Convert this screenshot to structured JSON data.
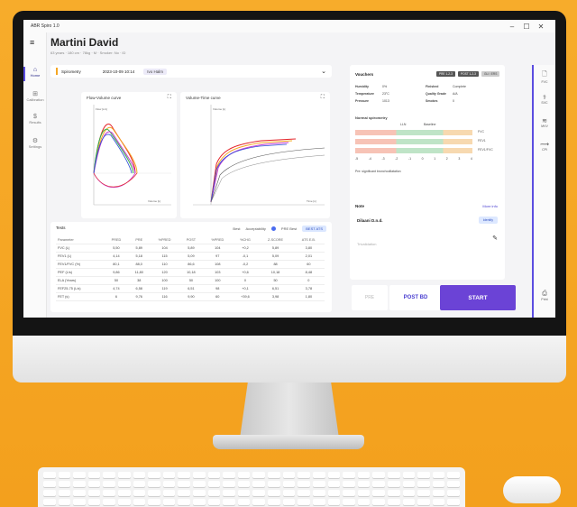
{
  "app": {
    "title": "ABR Spiro 1.0"
  },
  "window": {
    "minimize": "–",
    "maximize": "☐",
    "close": "✕"
  },
  "nav": {
    "menu_icon": "menu-icon",
    "items": [
      {
        "label": "Home",
        "icon": "home-icon",
        "glyph": "⌂"
      },
      {
        "label": "Calibration",
        "icon": "calibration-icon",
        "glyph": "⊞"
      },
      {
        "label": "Results",
        "icon": "results-icon",
        "glyph": "$"
      },
      {
        "label": "Settings",
        "icon": "gear-icon",
        "glyph": "⚙"
      }
    ]
  },
  "patient": {
    "name": "Martini David",
    "meta": "63 years · 180 cm · 78kg · M · Smoker: No · ID"
  },
  "test_bar": {
    "type": "Spirometry",
    "date": "2023-10-09 10:14",
    "badge": "Ivo Halm"
  },
  "charts": {
    "flow_volume": {
      "title": "Flow-Volume curve",
      "ylabel": "Flow [L/s]",
      "xlabel": "Volume [L]"
    },
    "volume_time": {
      "title": "Volume-Time curve",
      "ylabel": "Volume [L]",
      "xlabel": "Time [s]"
    }
  },
  "tests": {
    "label": "Tests",
    "best_label": "Best",
    "acceptability_label": "Acceptability",
    "pre_best_label": "PRE Best",
    "best_btn": "BEST ATS",
    "columns": [
      "Parameter",
      "PRED",
      "PRE",
      "%PRED",
      "POST",
      "%PRED",
      "%CHG",
      "Z-SCORE",
      "ATS E.B."
    ],
    "rows": [
      [
        "FVC (L)",
        "5,50",
        "5,89",
        "104",
        "5,89",
        "104",
        "+0,2",
        "5,89",
        "3,80"
      ],
      [
        "FEV1 (L)",
        "4,14",
        "5,18",
        "115",
        "5,09",
        "97",
        "-0,1",
        "5,09",
        "2,01"
      ],
      [
        "FEV1/FVC (%)",
        "80,1",
        "88,0",
        "110",
        "86,6",
        "108",
        "-0,2",
        "88",
        "60"
      ],
      [
        "PEF (L/s)",
        "9,86",
        "11,80",
        "120",
        "10,18",
        "103",
        "+0,6",
        "10,18",
        "8,48"
      ],
      [
        "ELA (Years)",
        "50",
        "38",
        "100",
        "50",
        "100",
        "0",
        "50",
        "0"
      ],
      [
        "FEF25-75 (L/s)",
        "4,74",
        "6,58",
        "119",
        "6,51",
        "98",
        "+0,1",
        "6,51",
        "3,78"
      ],
      [
        "FET (s)",
        "6",
        "9,76",
        "116",
        "9,90",
        "60",
        "+39,6",
        "3,98",
        "1,80"
      ]
    ]
  },
  "vouchers": {
    "title": "Vouchers",
    "tag1": "PRE 1-2-3",
    "tag2": "POST 1-2-3",
    "tag3": "GLI / ERS",
    "humidity_label": "Humidity",
    "humidity_value": "0%",
    "temperature_label": "Temperature",
    "temperature_value": "23°C",
    "pressure_label": "Pressure",
    "pressure_value": "1013",
    "quality_label": "Quality Grade",
    "quality_value": "A/A",
    "extra_label": "Smokes",
    "extra_value": "0",
    "status_label": "Finished",
    "status_value": "Complete"
  },
  "spirometry": {
    "title": "Normal spirometry",
    "lln_label": "LLN",
    "baseline_label": "Baseline",
    "scale": [
      "-5",
      "-4",
      "-3",
      "-2",
      "-1",
      "0",
      "1",
      "2",
      "3",
      "4"
    ],
    "rows": [
      "FVC",
      "FEV1",
      "FEV1/FVC"
    ],
    "footer": "Pre: significant bronchodilatation"
  },
  "notes": {
    "title": "Note",
    "more_info": "More info",
    "doctor": "Dilaani D.n.d.",
    "identify": "Identify",
    "placeholder": "Trivalidation"
  },
  "actions": {
    "pre": "PRE",
    "post": "POST BD",
    "start": "START"
  },
  "right_nav": {
    "items": [
      {
        "label": "FVC",
        "icon": "document-icon",
        "glyph": "🗋"
      },
      {
        "label": "SVC",
        "icon": "lungs-icon",
        "glyph": "⚕"
      },
      {
        "label": "MVV",
        "icon": "mvv-icon",
        "glyph": "≋"
      },
      {
        "label": "CPI",
        "icon": "cpi-icon",
        "glyph": "⟿"
      },
      {
        "label": "Print",
        "icon": "print-icon",
        "glyph": "⎙"
      }
    ]
  },
  "colors": {
    "accent": "#6b43d6",
    "highlight": "#f5a623"
  }
}
